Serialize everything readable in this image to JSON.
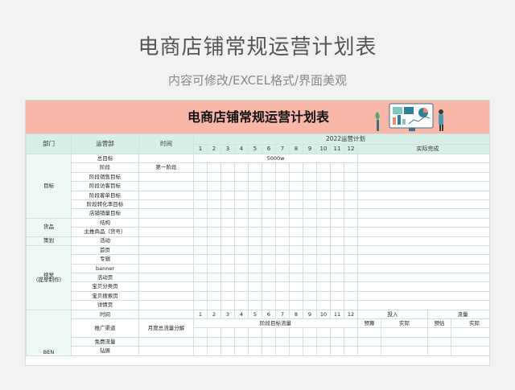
{
  "hero": {
    "title": "电商店铺常规运营计划表",
    "subtitle": "内容可修改/EXCEL格式/界面美观"
  },
  "sheet": {
    "title": "电商店铺常规运营计划表",
    "header": {
      "col_dept": "部门",
      "col_ops": "运营部",
      "col_time": "时间",
      "plan_label": "2022运营计划",
      "months": [
        "1",
        "2",
        "3",
        "4",
        "5",
        "6",
        "7",
        "8",
        "9",
        "10",
        "11",
        "12"
      ],
      "actual_label": "实际完成"
    },
    "rows": {
      "goal_group": "目标",
      "goal_items": [
        "总目标",
        "阶段",
        "阶段销售目标",
        "阶段访客目标",
        "阶段客单目标",
        "阶段转化率目标",
        "店铺销量目标"
      ],
      "stage_value": "第一阶段",
      "goal_value": "5000w",
      "goods_group": "货品",
      "goods_items": [
        "结构",
        "主推商品（货号）"
      ],
      "plan_group": "策划",
      "plan_items": [
        "活动"
      ],
      "visual_group_line1": "视觉",
      "visual_group_line2": "（提早制作）",
      "visual_items": [
        "首页",
        "专辑",
        "banner",
        "活动页",
        "宝贝分类页",
        "宝贝搜索页",
        "详情页"
      ],
      "traffic": {
        "time_label": "时间",
        "months": [
          "1",
          "2",
          "3",
          "4",
          "5",
          "6",
          "7",
          "8",
          "9",
          "10",
          "11",
          "12"
        ],
        "invest_label": "投入",
        "flow_label": "流量",
        "channel_label": "推广渠道",
        "monthly_split": "月度总流量分解",
        "stage_flow_target": "阶段目标流量",
        "budget": "预算",
        "actual1": "实际",
        "forecast": "预估",
        "actual2": "实际",
        "free_flow": "免费流量",
        "drill": "钻展",
        "partial_group": "BEN"
      }
    }
  }
}
